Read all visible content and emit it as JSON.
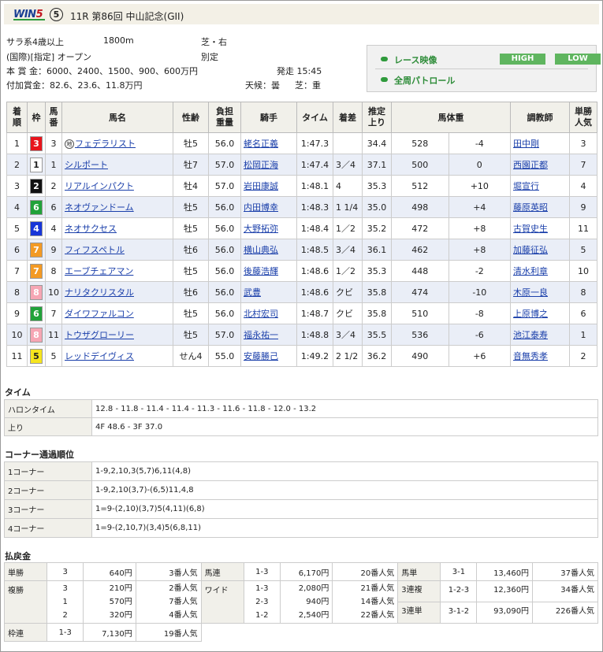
{
  "header": {
    "logo_text": "WIN",
    "logo_num": "5",
    "circle_num": "⑤",
    "race_title": "11R 第86回 中山記念(GII)"
  },
  "race_info": {
    "line1_left": "サラ系4歳以上",
    "distance": "1800m",
    "surface": "芝・右",
    "line2_left": "(国際)[指定] オープン",
    "weight_rule": "別定",
    "line3": "本 賞 金：6000、2400、1500、900、600万円",
    "post_time": "発走 15:45",
    "line4": "付加賞金：82.6、23.6、11.8万円",
    "weather": "天候：曇",
    "track": "芝：重"
  },
  "video": {
    "race_label": "レース映像",
    "patrol_label": "全周パトロール",
    "high": "HIGH",
    "low": "LOW"
  },
  "results": {
    "headers": [
      "着順",
      "枠",
      "馬番",
      "馬名",
      "性齢",
      "負担重量",
      "騎手",
      "タイム",
      "着差",
      "推定上り",
      "馬体重",
      "",
      "調教師",
      "単勝人気"
    ],
    "rows": [
      {
        "pos": "1",
        "waku": "3",
        "num": "3",
        "horse": "フェデラリスト",
        "maru": "地",
        "sexage": "牡5",
        "wt": "56.0",
        "jockey": "蛯名正義",
        "time": "1:47.3",
        "margin": "",
        "agari": "34.4",
        "bw": "528",
        "diff": "-4",
        "trainer": "田中剛",
        "pop": "3",
        "wc": "#e8141c",
        "wt_c": "#fff"
      },
      {
        "pos": "2",
        "waku": "1",
        "num": "1",
        "horse": "シルポート",
        "sexage": "牡7",
        "wt": "57.0",
        "jockey": "松岡正海",
        "time": "1:47.4",
        "margin": "3／4",
        "agari": "37.1",
        "bw": "500",
        "diff": "0",
        "trainer": "西園正都",
        "pop": "7",
        "wc": "#ffffff",
        "wt_c": "#222"
      },
      {
        "pos": "3",
        "waku": "2",
        "num": "2",
        "horse": "リアルインパクト",
        "sexage": "牡4",
        "wt": "57.0",
        "jockey": "岩田康誠",
        "time": "1:48.1",
        "margin": "4",
        "agari": "35.3",
        "bw": "512",
        "diff": "+10",
        "trainer": "堀宣行",
        "pop": "4",
        "wc": "#111111",
        "wt_c": "#fff"
      },
      {
        "pos": "4",
        "waku": "6",
        "num": "6",
        "horse": "ネオヴァンドーム",
        "sexage": "牡5",
        "wt": "56.0",
        "jockey": "内田博幸",
        "time": "1:48.3",
        "margin": "1 1/4",
        "agari": "35.0",
        "bw": "498",
        "diff": "+4",
        "trainer": "藤原英昭",
        "pop": "9",
        "wc": "#21a23a",
        "wt_c": "#fff"
      },
      {
        "pos": "5",
        "waku": "4",
        "num": "4",
        "horse": "ネオサクセス",
        "sexage": "牡5",
        "wt": "56.0",
        "jockey": "大野拓弥",
        "time": "1:48.4",
        "margin": "1／2",
        "agari": "35.2",
        "bw": "472",
        "diff": "+8",
        "trainer": "古賀史生",
        "pop": "11",
        "wc": "#1836d8",
        "wt_c": "#fff"
      },
      {
        "pos": "6",
        "waku": "7",
        "num": "9",
        "horse": "フィフスペトル",
        "sexage": "牡6",
        "wt": "56.0",
        "jockey": "横山典弘",
        "time": "1:48.5",
        "margin": "3／4",
        "agari": "36.1",
        "bw": "462",
        "diff": "+8",
        "trainer": "加藤征弘",
        "pop": "5",
        "wc": "#f39a24",
        "wt_c": "#fff"
      },
      {
        "pos": "7",
        "waku": "7",
        "num": "8",
        "horse": "エーブチェアマン",
        "sexage": "牡5",
        "wt": "56.0",
        "jockey": "後藤浩輝",
        "time": "1:48.6",
        "margin": "1／2",
        "agari": "35.3",
        "bw": "448",
        "diff": "-2",
        "trainer": "清水利章",
        "pop": "10",
        "wc": "#f39a24",
        "wt_c": "#fff"
      },
      {
        "pos": "8",
        "waku": "8",
        "num": "10",
        "horse": "ナリタクリスタル",
        "sexage": "牡6",
        "wt": "56.0",
        "jockey": "武豊",
        "time": "1:48.6",
        "margin": "クビ",
        "agari": "35.8",
        "bw": "474",
        "diff": "-10",
        "trainer": "木原一良",
        "pop": "8",
        "wc": "#f6a6b4",
        "wt_c": "#fff"
      },
      {
        "pos": "9",
        "waku": "6",
        "num": "7",
        "horse": "ダイワファルコン",
        "sexage": "牡5",
        "wt": "56.0",
        "jockey": "北村宏司",
        "time": "1:48.7",
        "margin": "クビ",
        "agari": "35.8",
        "bw": "510",
        "diff": "-8",
        "trainer": "上原博之",
        "pop": "6",
        "wc": "#21a23a",
        "wt_c": "#fff"
      },
      {
        "pos": "10",
        "waku": "8",
        "num": "11",
        "horse": "トウザグローリー",
        "sexage": "牡5",
        "wt": "57.0",
        "jockey": "福永祐一",
        "time": "1:48.8",
        "margin": "3／4",
        "agari": "35.5",
        "bw": "536",
        "diff": "-6",
        "trainer": "池江泰寿",
        "pop": "1",
        "wc": "#f6a6b4",
        "wt_c": "#fff"
      },
      {
        "pos": "11",
        "waku": "5",
        "num": "5",
        "horse": "レッドデイヴィス",
        "sexage": "せん4",
        "wt": "55.0",
        "jockey": "安藤勝己",
        "time": "1:49.2",
        "margin": "2 1/2",
        "agari": "36.2",
        "bw": "490",
        "diff": "+6",
        "trainer": "音無秀孝",
        "pop": "2",
        "wc": "#f6e51e",
        "wt_c": "#222"
      }
    ]
  },
  "time_section": {
    "title": "タイム",
    "rows": [
      {
        "label": "ハロンタイム",
        "value": "12.8 - 11.8 - 11.4 - 11.4 - 11.3 - 11.6 - 11.8 - 12.0 - 13.2"
      },
      {
        "label": "上り",
        "value": "4F 48.6 - 3F 37.0"
      }
    ]
  },
  "corner_section": {
    "title": "コーナー通過順位",
    "rows": [
      {
        "label": "1コーナー",
        "value": "1-9,2,10,3(5,7)6,11(4,8)"
      },
      {
        "label": "2コーナー",
        "value": "1-9,2,10(3,7)-(6,5)11,4,8"
      },
      {
        "label": "3コーナー",
        "value": "1=9-(2,10)(3,7)5(4,11)(6,8)"
      },
      {
        "label": "4コーナー",
        "value": "1=9-(2,10,7)(3,4)5(6,8,11)"
      }
    ]
  },
  "payout": {
    "title": "払戻金",
    "tansho": {
      "label": "単勝",
      "nums": [
        "3"
      ],
      "pay": [
        "640円"
      ],
      "pop": [
        "3番人気"
      ]
    },
    "fukusho": {
      "label": "複勝",
      "nums": [
        "3",
        "1",
        "2"
      ],
      "pay": [
        "210円",
        "570円",
        "320円"
      ],
      "pop": [
        "2番人気",
        "7番人気",
        "4番人気"
      ]
    },
    "wakuren": {
      "label": "枠連",
      "nums": [
        "1-3"
      ],
      "pay": [
        "7,130円"
      ],
      "pop": [
        "19番人気"
      ]
    },
    "umaren": {
      "label": "馬連",
      "nums": [
        "1-3"
      ],
      "pay": [
        "6,170円"
      ],
      "pop": [
        "20番人気"
      ]
    },
    "wide": {
      "label": "ワイド",
      "nums": [
        "1-3",
        "2-3",
        "1-2"
      ],
      "pay": [
        "2,080円",
        "940円",
        "2,540円"
      ],
      "pop": [
        "21番人気",
        "14番人気",
        "22番人気"
      ]
    },
    "umatan": {
      "label": "馬単",
      "nums": [
        "3-1"
      ],
      "pay": [
        "13,460円"
      ],
      "pop": [
        "37番人気"
      ]
    },
    "sanfuku": {
      "label": "3連複",
      "nums": [
        "1-2-3"
      ],
      "pay": [
        "12,360円"
      ],
      "pop": [
        "34番人気"
      ]
    },
    "santan": {
      "label": "3連単",
      "nums": [
        "3-1-2"
      ],
      "pay": [
        "93,090円"
      ],
      "pop": [
        "226番人気"
      ]
    }
  }
}
